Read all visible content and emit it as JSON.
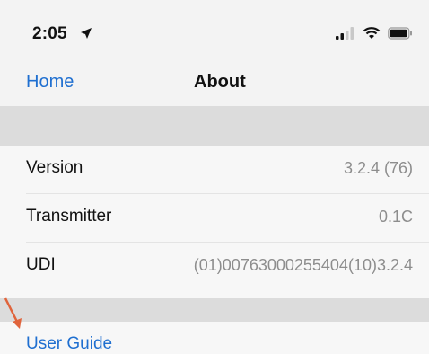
{
  "status_bar": {
    "time": "2:05",
    "icons": [
      "location-arrow-icon",
      "cellular-signal-icon",
      "wifi-icon",
      "battery-icon"
    ]
  },
  "nav": {
    "back_label": "Home",
    "title": "About"
  },
  "info": [
    {
      "label": "Version",
      "value": "3.2.4 (76)"
    },
    {
      "label": "Transmitter",
      "value": "0.1C"
    },
    {
      "label": "UDI",
      "value": "(01)00763000255404(10)3.2.4"
    }
  ],
  "links": {
    "user_guide": "User Guide"
  },
  "colors": {
    "link": "#1f6fd0",
    "value_text": "#8d8d8d",
    "annotation_arrow": "#e0643c"
  }
}
